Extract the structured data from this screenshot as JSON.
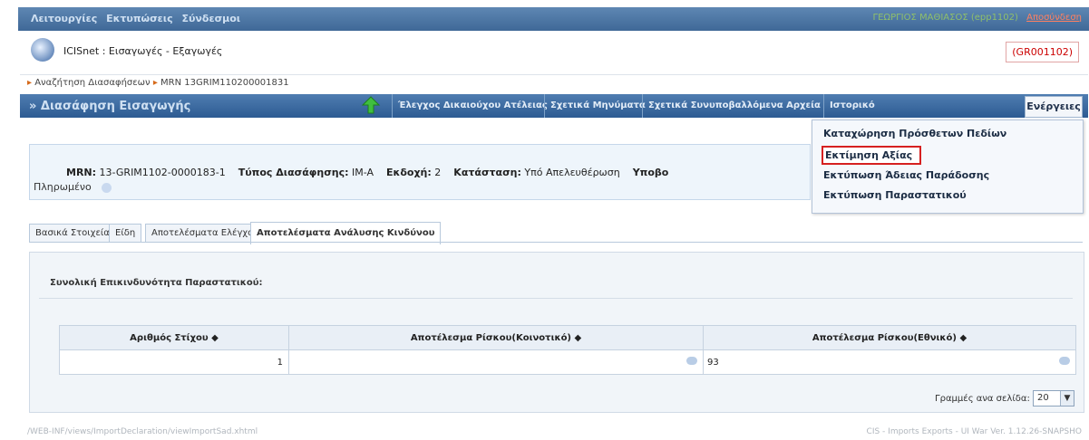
{
  "topbar": {
    "menu": [
      "Λειτουργίες",
      "Εκτυπώσεις",
      "Σύνδεσμοι"
    ],
    "user": "ΓΕΩΡΓΙΟΣ ΜΑΘΙΑΣΟΣ (epp1102)",
    "logout": "Αποσύνδεση"
  },
  "app": {
    "title": "ICISnet : Εισαγωγές - Εξαγωγές",
    "code": "(GR001102)"
  },
  "breadcrumb": {
    "search": "Αναζήτηση Διασαφήσεων",
    "mrn": "MRN 13GRIM110200001831"
  },
  "mainbar": {
    "title": "» Διασάφηση Εισαγωγής",
    "tabs": [
      "Έλεγχος Δικαιούχου Ατέλειας",
      "Σχετικά Μηνύματα",
      "Σχετικά Συνυποβαλλόμενα Αρχεία",
      "Ιστορικό"
    ],
    "actions": "Ενέργειες"
  },
  "dropdown": {
    "items": [
      "Καταχώρηση Πρόσθετων Πεδίων",
      "Εκτίμηση Αξίας",
      "Εκτύπωση Άδειας Παράδοσης",
      "Εκτύπωση Παραστατικού"
    ]
  },
  "info": {
    "mrn_label": "MRN:",
    "mrn_value": "13-GRIM1102-0000183-1",
    "type_label": "Τύπος Διασάφησης:",
    "type_value": "IM-A",
    "version_label": "Εκδοχή:",
    "version_value": "2",
    "status_label": "Κατάσταση:",
    "status_value": "Υπό Απελευθέρωση",
    "submitted_label": "Υποβο",
    "paid": "Πληρωμένο"
  },
  "subtabs": [
    "Βασικά Στοιχεία",
    "Είδη",
    "Αποτελέσματα Ελέγχου",
    "Αποτελέσματα Ανάλυσης Κινδύνου"
  ],
  "panel": {
    "title": "Συνολική Επικινδυνότητα Παραστατικού:",
    "columns": [
      "Αριθμός Στίχου ◆",
      "Αποτέλεσμα Ρίσκου(Κοινοτικό) ◆",
      "Αποτέλεσμα Ρίσκου(Εθνικό) ◆"
    ],
    "rows": [
      {
        "line": "1",
        "community": "",
        "national": "93"
      }
    ],
    "rows_per_page_label": "Γραμμές ανα σελίδα:",
    "rows_per_page_value": "20"
  },
  "footer": {
    "left": "/WEB-INF/views/ImportDeclaration/viewImportSad.xhtml",
    "right": "CIS - Imports Exports - UI War Ver. 1.12.26-SNAPSHO"
  }
}
